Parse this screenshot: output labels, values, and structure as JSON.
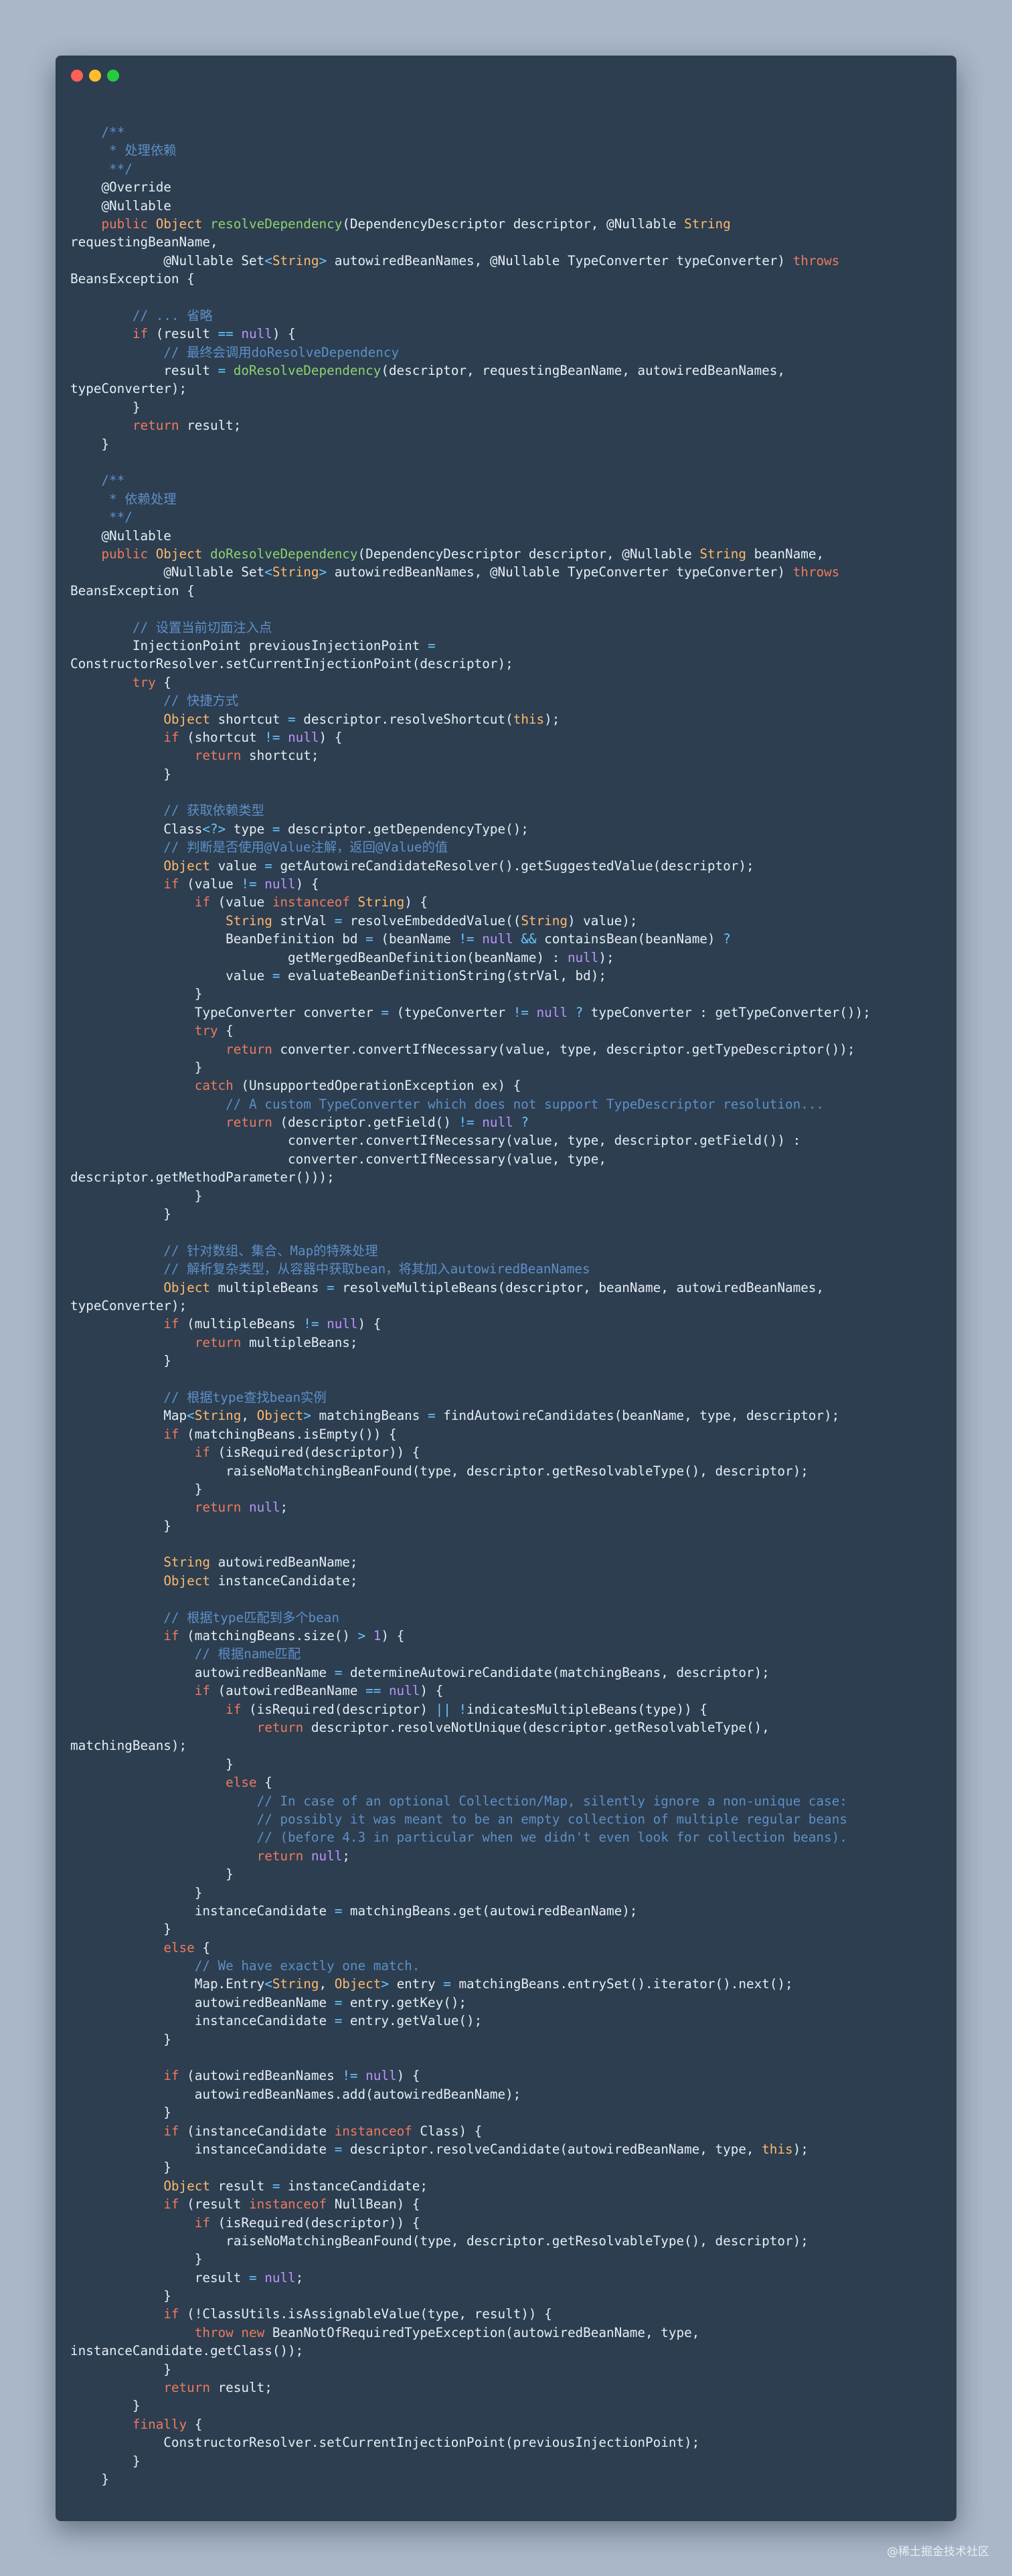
{
  "window": {
    "controls": {
      "close_color": "#ff5f56",
      "minimize_color": "#ffbd2e",
      "maximize_color": "#27c93f"
    }
  },
  "theme": {
    "background": "#2c3e50",
    "text": "#e6edf5",
    "keyword": "#ef7a5d",
    "type": "#ffb86c",
    "function": "#8fd16f",
    "comment": "#5f8fc7",
    "literal": "#bd93f9",
    "operator": "#6cc6ff"
  },
  "code_lines": [
    "    /**",
    "     * 处理依赖",
    "     **/",
    "    @Override",
    "    @Nullable",
    "    public Object resolveDependency(DependencyDescriptor descriptor, @Nullable String",
    "requestingBeanName,",
    "            @Nullable Set<String> autowiredBeanNames, @Nullable TypeConverter typeConverter) throws",
    "BeansException {",
    "",
    "        // ... 省略",
    "        if (result == null) {",
    "            // 最终会调用doResolveDependency",
    "            result = doResolveDependency(descriptor, requestingBeanName, autowiredBeanNames,",
    "typeConverter);",
    "        }",
    "        return result;",
    "    }",
    "",
    "    /**",
    "     * 依赖处理",
    "     **/",
    "    @Nullable",
    "    public Object doResolveDependency(DependencyDescriptor descriptor, @Nullable String beanName,",
    "            @Nullable Set<String> autowiredBeanNames, @Nullable TypeConverter typeConverter) throws",
    "BeansException {",
    "",
    "        // 设置当前切面注入点",
    "        InjectionPoint previousInjectionPoint =",
    "ConstructorResolver.setCurrentInjectionPoint(descriptor);",
    "        try {",
    "            // 快捷方式",
    "            Object shortcut = descriptor.resolveShortcut(this);",
    "            if (shortcut != null) {",
    "                return shortcut;",
    "            }",
    "",
    "            // 获取依赖类型",
    "            Class<?> type = descriptor.getDependencyType();",
    "            // 判断是否使用@Value注解，返回@Value的值",
    "            Object value = getAutowireCandidateResolver().getSuggestedValue(descriptor);",
    "            if (value != null) {",
    "                if (value instanceof String) {",
    "                    String strVal = resolveEmbeddedValue((String) value);",
    "                    BeanDefinition bd = (beanName != null && containsBean(beanName) ?",
    "                            getMergedBeanDefinition(beanName) : null);",
    "                    value = evaluateBeanDefinitionString(strVal, bd);",
    "                }",
    "                TypeConverter converter = (typeConverter != null ? typeConverter : getTypeConverter());",
    "                try {",
    "                    return converter.convertIfNecessary(value, type, descriptor.getTypeDescriptor());",
    "                }",
    "                catch (UnsupportedOperationException ex) {",
    "                    // A custom TypeConverter which does not support TypeDescriptor resolution...",
    "                    return (descriptor.getField() != null ?",
    "                            converter.convertIfNecessary(value, type, descriptor.getField()) :",
    "                            converter.convertIfNecessary(value, type,",
    "descriptor.getMethodParameter()));",
    "                }",
    "            }",
    "",
    "            // 针对数组、集合、Map的特殊处理",
    "            // 解析复杂类型，从容器中获取bean，将其加入autowiredBeanNames",
    "            Object multipleBeans = resolveMultipleBeans(descriptor, beanName, autowiredBeanNames,",
    "typeConverter);",
    "            if (multipleBeans != null) {",
    "                return multipleBeans;",
    "            }",
    "",
    "            // 根据type查找bean实例",
    "            Map<String, Object> matchingBeans = findAutowireCandidates(beanName, type, descriptor);",
    "            if (matchingBeans.isEmpty()) {",
    "                if (isRequired(descriptor)) {",
    "                    raiseNoMatchingBeanFound(type, descriptor.getResolvableType(), descriptor);",
    "                }",
    "                return null;",
    "            }",
    "",
    "            String autowiredBeanName;",
    "            Object instanceCandidate;",
    "",
    "            // 根据type匹配到多个bean",
    "            if (matchingBeans.size() > 1) {",
    "                // 根据name匹配",
    "                autowiredBeanName = determineAutowireCandidate(matchingBeans, descriptor);",
    "                if (autowiredBeanName == null) {",
    "                    if (isRequired(descriptor) || !indicatesMultipleBeans(type)) {",
    "                        return descriptor.resolveNotUnique(descriptor.getResolvableType(),",
    "matchingBeans);",
    "                    }",
    "                    else {",
    "                        // In case of an optional Collection/Map, silently ignore a non-unique case:",
    "                        // possibly it was meant to be an empty collection of multiple regular beans",
    "                        // (before 4.3 in particular when we didn't even look for collection beans).",
    "                        return null;",
    "                    }",
    "                }",
    "                instanceCandidate = matchingBeans.get(autowiredBeanName);",
    "            }",
    "            else {",
    "                // We have exactly one match.",
    "                Map.Entry<String, Object> entry = matchingBeans.entrySet().iterator().next();",
    "                autowiredBeanName = entry.getKey();",
    "                instanceCandidate = entry.getValue();",
    "            }",
    "",
    "            if (autowiredBeanNames != null) {",
    "                autowiredBeanNames.add(autowiredBeanName);",
    "            }",
    "            if (instanceCandidate instanceof Class) {",
    "                instanceCandidate = descriptor.resolveCandidate(autowiredBeanName, type, this);",
    "            }",
    "            Object result = instanceCandidate;",
    "            if (result instanceof NullBean) {",
    "                if (isRequired(descriptor)) {",
    "                    raiseNoMatchingBeanFound(type, descriptor.getResolvableType(), descriptor);",
    "                }",
    "                result = null;",
    "            }",
    "            if (!ClassUtils.isAssignableValue(type, result)) {",
    "                throw new BeanNotOfRequiredTypeException(autowiredBeanName, type,",
    "instanceCandidate.getClass());",
    "            }",
    "            return result;",
    "        }",
    "        finally {",
    "            ConstructorResolver.setCurrentInjectionPoint(previousInjectionPoint);",
    "        }",
    "    }"
  ],
  "watermark": "@稀土掘金技术社区"
}
